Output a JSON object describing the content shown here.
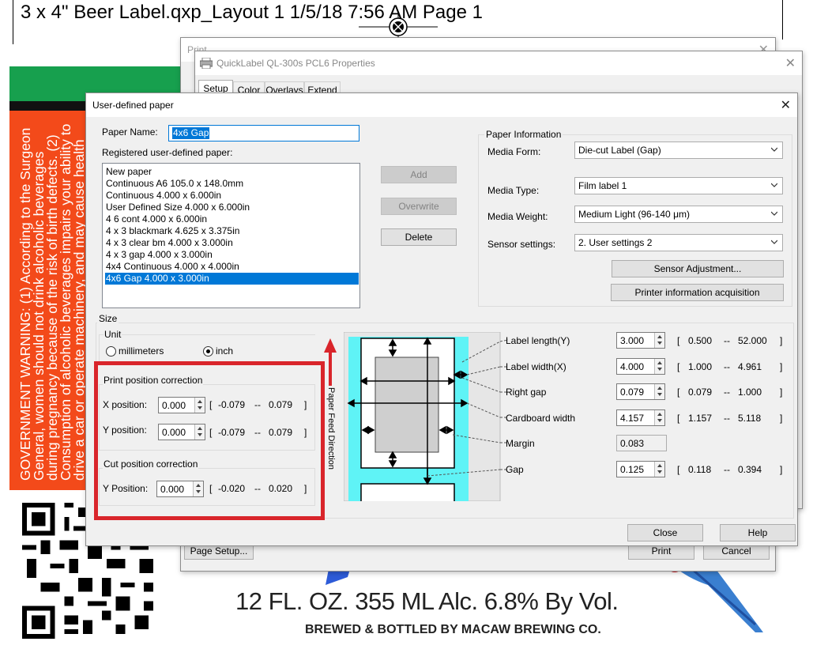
{
  "background_doc": {
    "title": "3 x 4\" Beer Label.qxp_Layout 1  1/5/18  7:56 AM  Page 1",
    "warning_text": "GOVERNMENT WARNING: (1) According to the Surgeon General, women should not drink alcoholic beverages during pregnancy because of the risk of birth defects. (2) Consumption of alcoholic beverages impairs your ability to drive a car or operate machinery, and may cause health problems.",
    "volume_text": "12 FL. OZ. 355 ML     Alc. 6.8% By Vol.",
    "brewer_text": "BREWED & BOTTLED BY MACAW BREWING CO.",
    "colors": {
      "green": "#17a04e",
      "red": "#f34a1a"
    }
  },
  "print_dialog": {
    "title": "Print",
    "page_setup_label": "Page Setup...",
    "print_label": "Print",
    "cancel_label": "Cancel"
  },
  "properties_dialog": {
    "title": "QuickLabel QL-300s PCL6 Properties",
    "tabs": [
      "Setup",
      "Color",
      "Overlays",
      "Extend"
    ]
  },
  "udp_dialog": {
    "title": "User-defined paper",
    "paper_name_label": "Paper Name:",
    "paper_name_value": "4x6 Gap",
    "registered_label": "Registered user-defined paper:",
    "papers": [
      "New paper",
      "Continuous A6 105.0 x 148.0mm",
      "Continuous 4.000 x 6.000in",
      "User Defined Size 4.000 x 6.000in",
      "4 6 cont 4.000 x 6.000in",
      "4 x 3 blackmark 4.625 x 3.375in",
      "4 x 3 clear bm 4.000 x 3.000in",
      "4 x 3 gap 4.000 x 3.000in",
      "4x4 Continuous 4.000 x 4.000in",
      "4x6 Gap 4.000 x 3.000in"
    ],
    "selected_paper_index": 9,
    "add_label": "Add",
    "overwrite_label": "Overwrite",
    "delete_label": "Delete",
    "paper_info": {
      "group_label": "Paper Information",
      "media_form_label": "Media Form:",
      "media_form_value": "Die-cut Label (Gap)",
      "media_type_label": "Media Type:",
      "media_type_value": "Film label 1",
      "media_weight_label": "Media Weight:",
      "media_weight_value": "Medium Light (96-140 μm)",
      "sensor_label": "Sensor settings:",
      "sensor_value": "2. User settings 2",
      "sensor_adjust_label": "Sensor Adjustment...",
      "printer_info_label": "Printer information acquisition"
    },
    "size": {
      "group_label": "Size",
      "unit_label": "Unit",
      "mm_label": "millimeters",
      "inch_label": "inch",
      "selected_unit": "inch"
    },
    "print_position": {
      "group_label": "Print position correction",
      "x_label": "X position:",
      "x_value": "0.000",
      "x_min": "-0.079",
      "x_max": "0.079",
      "y_label": "Y position:",
      "y_value": "0.000",
      "y_min": "-0.079",
      "y_max": "0.079"
    },
    "cut_position": {
      "group_label": "Cut position correction",
      "y_label": "Y Position:",
      "y_value": "0.000",
      "y_min": "-0.020",
      "y_max": "0.020"
    },
    "feed_direction_label": "Paper Feed Direction",
    "dims": [
      {
        "label": "Label length(Y)",
        "value": "3.000",
        "min": "0.500",
        "max": "52.000",
        "editable": true
      },
      {
        "label": "Label width(X)",
        "value": "4.000",
        "min": "1.000",
        "max": "4.961",
        "editable": true
      },
      {
        "label": "Right gap",
        "value": "0.079",
        "min": "0.079",
        "max": "1.000",
        "editable": true
      },
      {
        "label": "Cardboard width",
        "value": "4.157",
        "min": "1.157",
        "max": "5.118",
        "editable": true
      },
      {
        "label": "Margin",
        "value": "0.083",
        "min": "",
        "max": "",
        "editable": false
      },
      {
        "label": "Gap",
        "value": "0.125",
        "min": "0.118",
        "max": "0.394",
        "editable": true
      }
    ],
    "range_open": "[",
    "range_sep": "--",
    "range_close": "]",
    "close_label": "Close",
    "help_label": "Help",
    "highlight_color": "#d9252b"
  }
}
